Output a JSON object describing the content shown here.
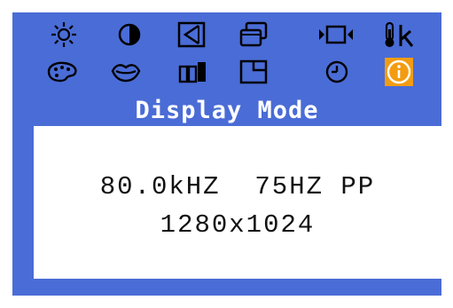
{
  "colors": {
    "background": "#4a6cd6",
    "icon": "#000000",
    "info_accent": "#f39c12",
    "panel": "#ffffff"
  },
  "menu": {
    "icons": [
      {
        "name": "brightness-icon"
      },
      {
        "name": "contrast-icon"
      },
      {
        "name": "position-icon"
      },
      {
        "name": "size-icon"
      },
      {
        "name": "video-input-icon"
      },
      {
        "name": "temperature-k-icon"
      },
      {
        "name": "color-palette-icon"
      },
      {
        "name": "lips-icon"
      },
      {
        "name": "moire-icon"
      },
      {
        "name": "zoom-corner-icon"
      },
      {
        "name": "clock-icon"
      },
      {
        "name": "info-icon",
        "active": true
      }
    ]
  },
  "title": "Display Mode",
  "info": {
    "frequency_line": "80.0kHZ  75HZ PP",
    "resolution": "1280x1024"
  }
}
